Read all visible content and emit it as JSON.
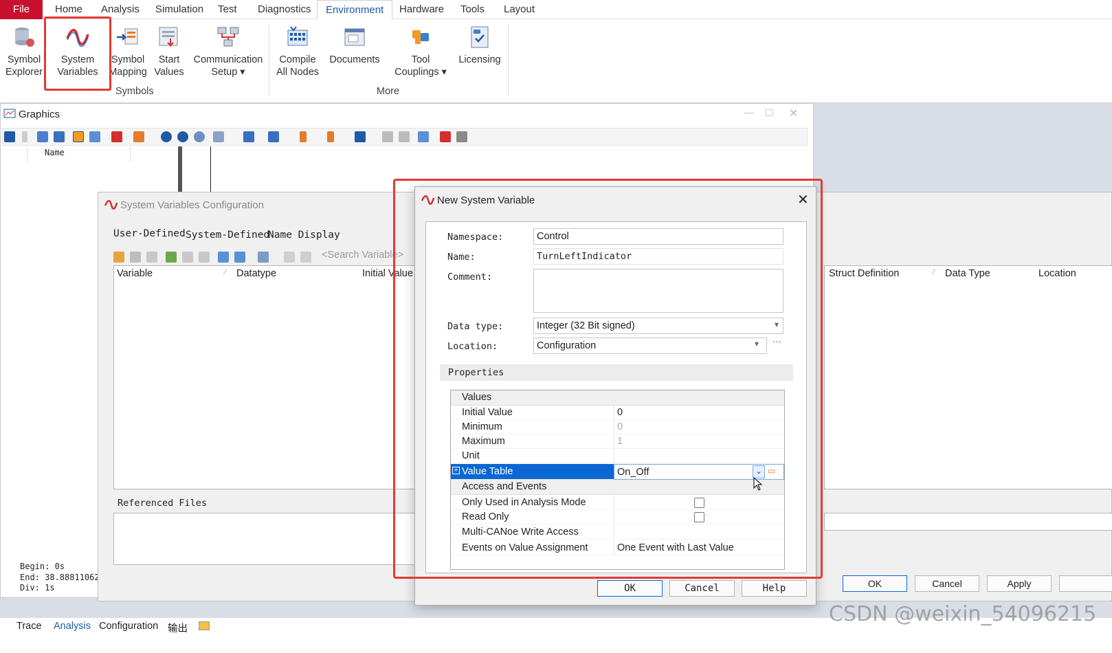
{
  "menu": {
    "file": "File",
    "items": [
      "Home",
      "Analysis",
      "Simulation",
      "Test",
      "Diagnostics",
      "Environment",
      "Hardware",
      "Tools",
      "Layout"
    ],
    "active": "Environment"
  },
  "ribbon": {
    "symbol_explorer": [
      "Symbol",
      "Explorer"
    ],
    "system_variables": [
      "System",
      "Variables"
    ],
    "symbol_mapping": [
      "Symbol",
      "Mapping"
    ],
    "start_values": [
      "Start",
      "Values"
    ],
    "communication_setup": [
      "Communication",
      "Setup ▾"
    ],
    "compile_all_nodes": [
      "Compile",
      "All Nodes"
    ],
    "documents": "Documents",
    "tool_couplings": [
      "Tool",
      "Couplings ▾"
    ],
    "licensing": "Licensing",
    "group_symbols": "Symbols",
    "group_more": "More"
  },
  "graphics": {
    "title": "Graphics",
    "legend_col": "Name",
    "begin": "Begin: 0s",
    "end": "End:  38.888110626",
    "div": "Div:  1s"
  },
  "svc": {
    "title": "System Variables Configuration",
    "tabs": [
      "User-Defined",
      "System-Defined",
      "Name Display"
    ],
    "search_placeholder": "<Search Variable>",
    "columns": [
      "Variable",
      "Datatype",
      "Initial Value"
    ],
    "right_columns": [
      "Struct Definition",
      "Data Type",
      "Location"
    ],
    "referenced_files": "Referenced Files",
    "ok": "OK",
    "cancel": "Cancel",
    "apply": "Apply"
  },
  "dialog": {
    "title": "New System Variable",
    "namespace_label": "Namespace:",
    "namespace_value": "Control",
    "name_label": "Name:",
    "name_value": "TurnLeftIndicator",
    "comment_label": "Comment:",
    "comment_value": "",
    "datatype_label": "Data type:",
    "datatype_value": "Integer (32 Bit signed)",
    "location_label": "Location:",
    "location_value": "Configuration",
    "properties_label": "Properties",
    "values_section": "Values",
    "initial_value_label": "Initial Value",
    "initial_value": "0",
    "minimum_label": "Minimum",
    "minimum": "0",
    "maximum_label": "Maximum",
    "maximum": "1",
    "unit_label": "Unit",
    "unit": "",
    "value_table_label": "Value Table",
    "value_table": "On_Off",
    "access_section": "Access and Events",
    "analysis_mode_label": "Only Used in Analysis Mode",
    "read_only_label": "Read Only",
    "multi_canoe_label": "Multi-CANoe Write Access",
    "events_label": "Events on Value Assignment",
    "events_value": "One Event with Last Value",
    "ok": "OK",
    "cancel": "Cancel",
    "help": "Help"
  },
  "status_tabs": [
    "Trace",
    "Analysis",
    "Configuration",
    "输出"
  ],
  "watermark": "CSDN @weixin_54096215",
  "colors": {
    "accent": "#0a67d4",
    "highlight": "#e53935",
    "file_tab": "#c8102e"
  }
}
